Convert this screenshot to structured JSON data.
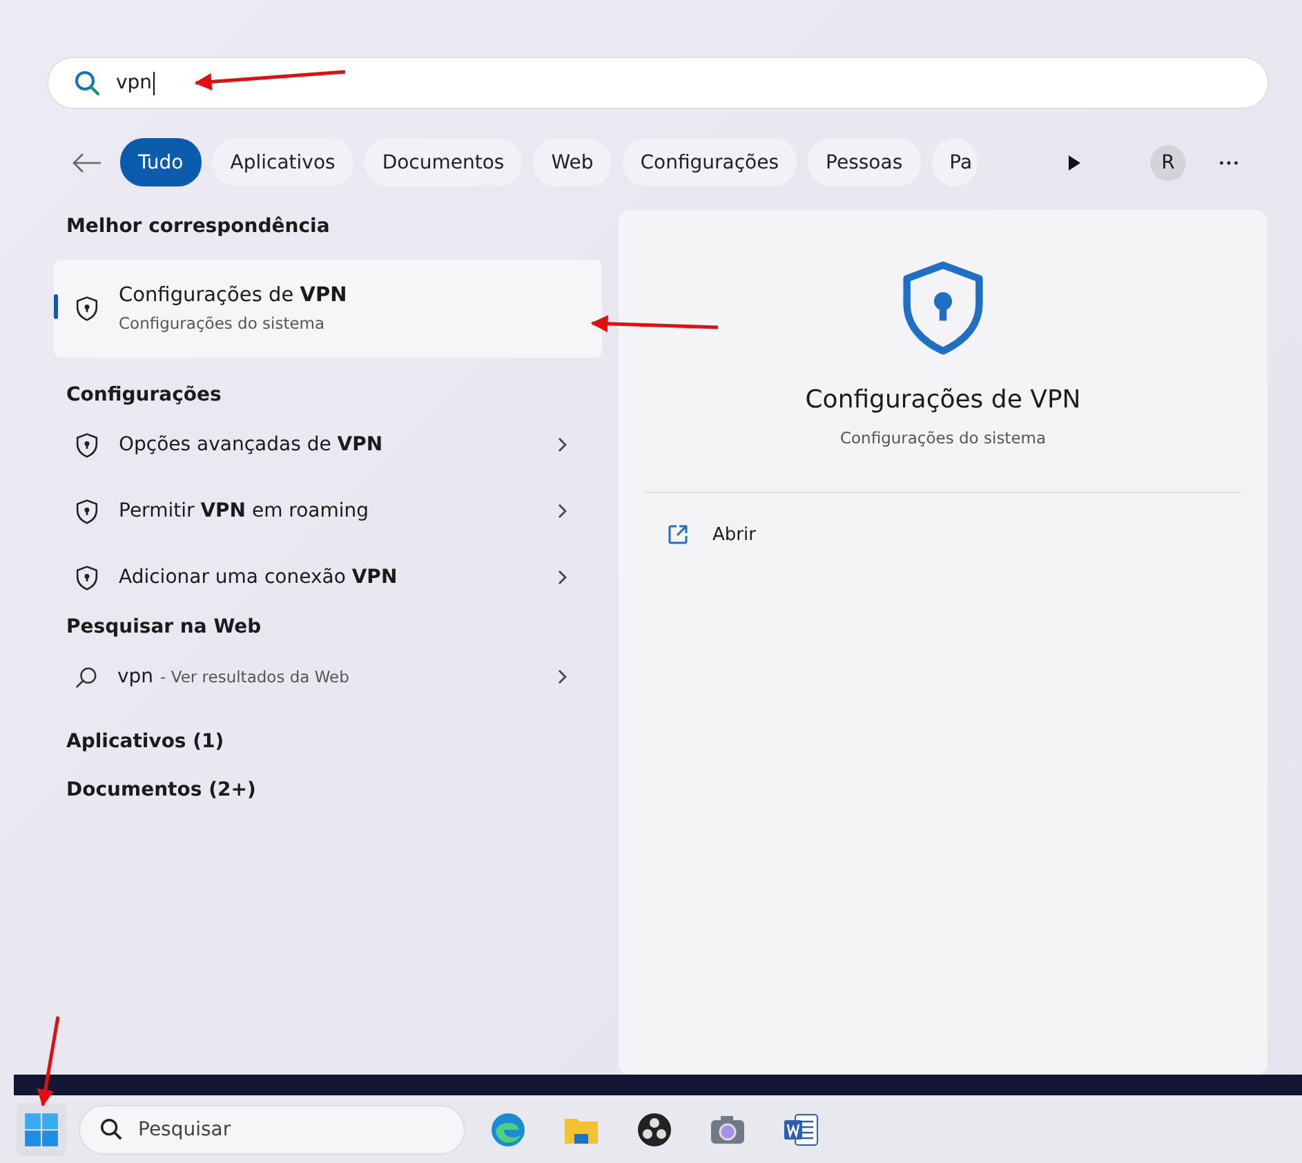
{
  "search": {
    "value": "vpn"
  },
  "filters": [
    {
      "label": "Tudo",
      "selected": true
    },
    {
      "label": "Aplicativos",
      "selected": false
    },
    {
      "label": "Documentos",
      "selected": false
    },
    {
      "label": "Web",
      "selected": false
    },
    {
      "label": "Configurações",
      "selected": false
    },
    {
      "label": "Pessoas",
      "selected": false
    },
    {
      "label": "Pa",
      "selected": false
    }
  ],
  "account": {
    "initial": "R"
  },
  "best_match": {
    "heading": "Melhor correspondência",
    "title": "Configurações de **VPN**",
    "subtitle": "Configurações do sistema",
    "selected": true
  },
  "settings": {
    "heading": "Configurações",
    "items": [
      {
        "label": "Opções avançadas de **VPN**"
      },
      {
        "label": "Permitir **VPN** em roaming"
      },
      {
        "label": "Adicionar uma conexão **VPN**"
      }
    ]
  },
  "web": {
    "heading": "Pesquisar na Web",
    "query": "vpn",
    "hint": "- Ver resultados da Web"
  },
  "more_sections": [
    {
      "label": "Aplicativos (1)"
    },
    {
      "label": "Documentos (2+)"
    }
  ],
  "preview": {
    "title": "Configurações de VPN",
    "subtitle": "Configurações do sistema",
    "actions": [
      {
        "label": "Abrir"
      }
    ]
  },
  "taskbar": {
    "search_placeholder": "Pesquisar",
    "apps": [
      {
        "kind": "browser"
      },
      {
        "kind": "folder"
      },
      {
        "kind": "recorder"
      },
      {
        "kind": "camera"
      },
      {
        "kind": "word"
      }
    ]
  }
}
